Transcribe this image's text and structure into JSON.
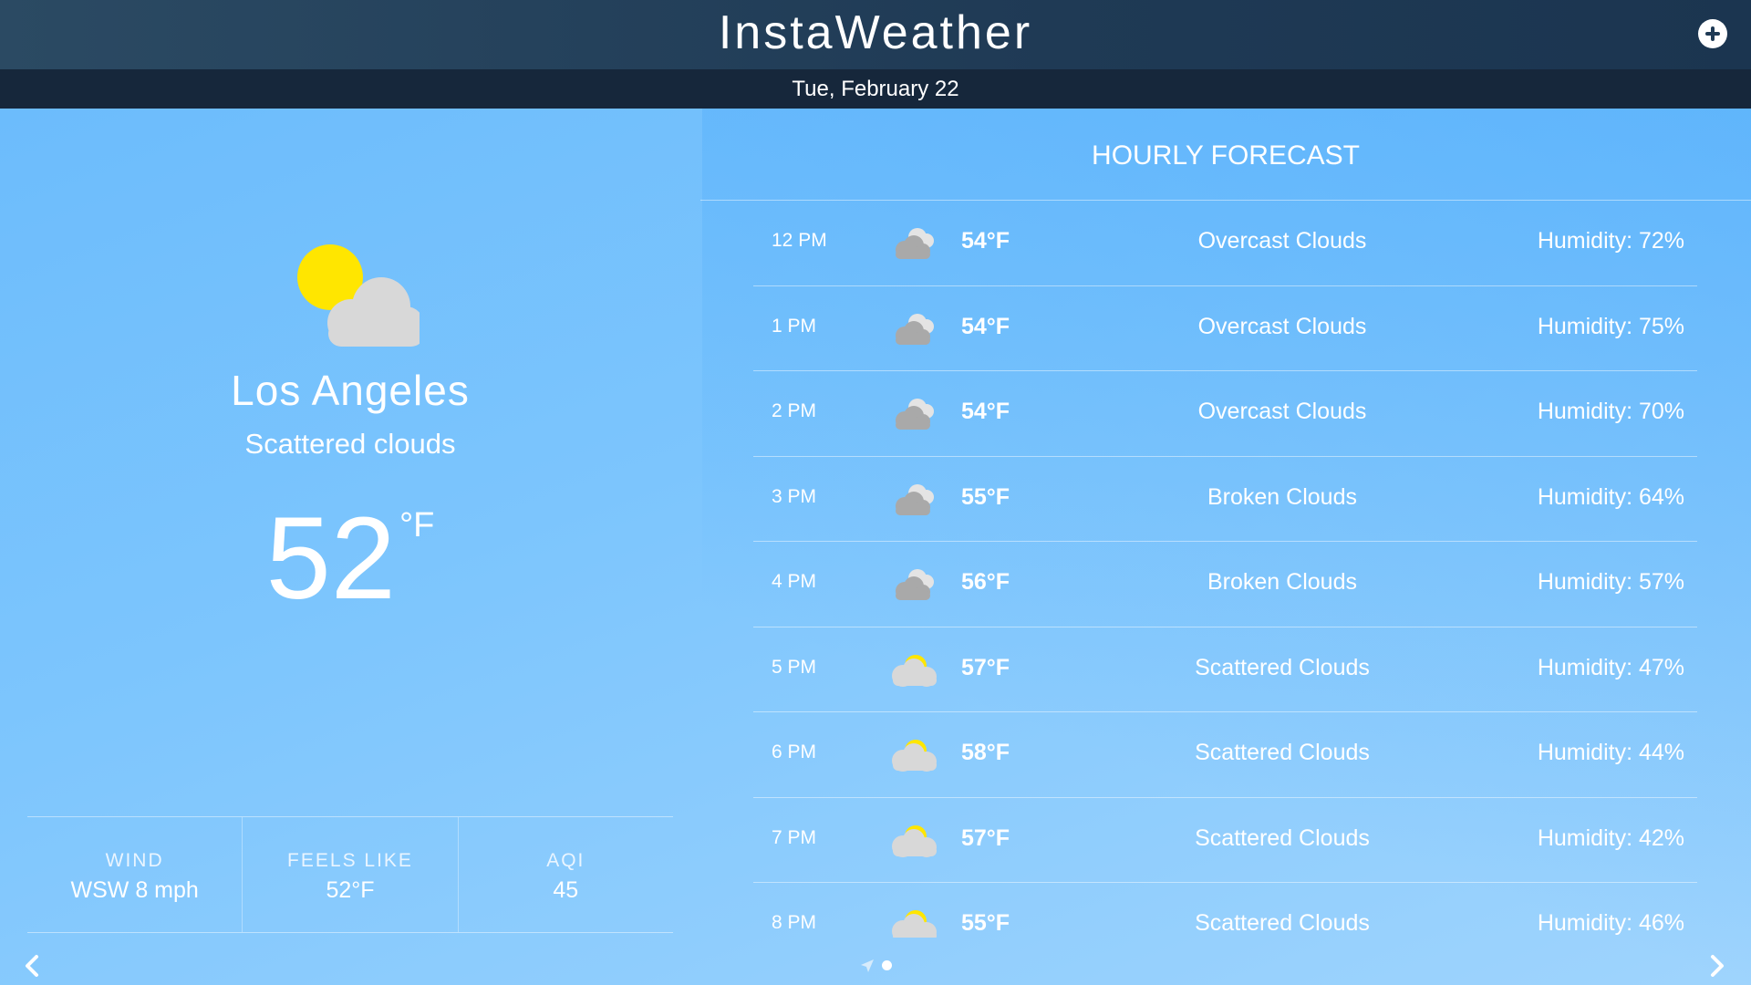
{
  "app": {
    "title": "InstaWeather",
    "date": "Tue, February 22",
    "add_icon": "plus-circle-icon"
  },
  "current": {
    "city": "Los Angeles",
    "condition": "Scattered clouds",
    "temperature": "52",
    "unit": "°F",
    "icon": "partly-cloudy-icon",
    "stats": [
      {
        "label": "WIND",
        "value": "WSW 8 mph"
      },
      {
        "label": "FEELS LIKE",
        "value": "52°F"
      },
      {
        "label": "AQI",
        "value": "45"
      }
    ]
  },
  "hourly": {
    "title": "HOURLY FORECAST",
    "rows": [
      {
        "time": "12 PM",
        "icon": "cloud-icon",
        "temp": "54°F",
        "desc": "Overcast Clouds",
        "humidity": "Humidity: 72%"
      },
      {
        "time": "1 PM",
        "icon": "cloud-icon",
        "temp": "54°F",
        "desc": "Overcast Clouds",
        "humidity": "Humidity: 75%"
      },
      {
        "time": "2 PM",
        "icon": "cloud-icon",
        "temp": "54°F",
        "desc": "Overcast Clouds",
        "humidity": "Humidity: 70%"
      },
      {
        "time": "3 PM",
        "icon": "cloud-icon",
        "temp": "55°F",
        "desc": "Broken Clouds",
        "humidity": "Humidity: 64%"
      },
      {
        "time": "4 PM",
        "icon": "cloud-icon",
        "temp": "56°F",
        "desc": "Broken Clouds",
        "humidity": "Humidity: 57%"
      },
      {
        "time": "5 PM",
        "icon": "partly-cloudy-icon",
        "temp": "57°F",
        "desc": "Scattered Clouds",
        "humidity": "Humidity: 47%"
      },
      {
        "time": "6 PM",
        "icon": "partly-cloudy-icon",
        "temp": "58°F",
        "desc": "Scattered Clouds",
        "humidity": "Humidity: 44%"
      },
      {
        "time": "7 PM",
        "icon": "partly-cloudy-icon",
        "temp": "57°F",
        "desc": "Scattered Clouds",
        "humidity": "Humidity: 42%"
      },
      {
        "time": "8 PM",
        "icon": "partly-cloudy-icon",
        "temp": "55°F",
        "desc": "Scattered Clouds",
        "humidity": "Humidity: 46%"
      }
    ]
  },
  "nav": {
    "prev_icon": "chevron-left-icon",
    "next_icon": "chevron-right-icon",
    "location_icon": "location-arrow-icon",
    "page_indicator_icon": "page-dot-icon"
  },
  "colors": {
    "header": "#1f3a55",
    "date_bar": "#16273b",
    "sky": "#6cbcfc",
    "sun": "#ffe600",
    "cloud": "#d8d8d8"
  }
}
